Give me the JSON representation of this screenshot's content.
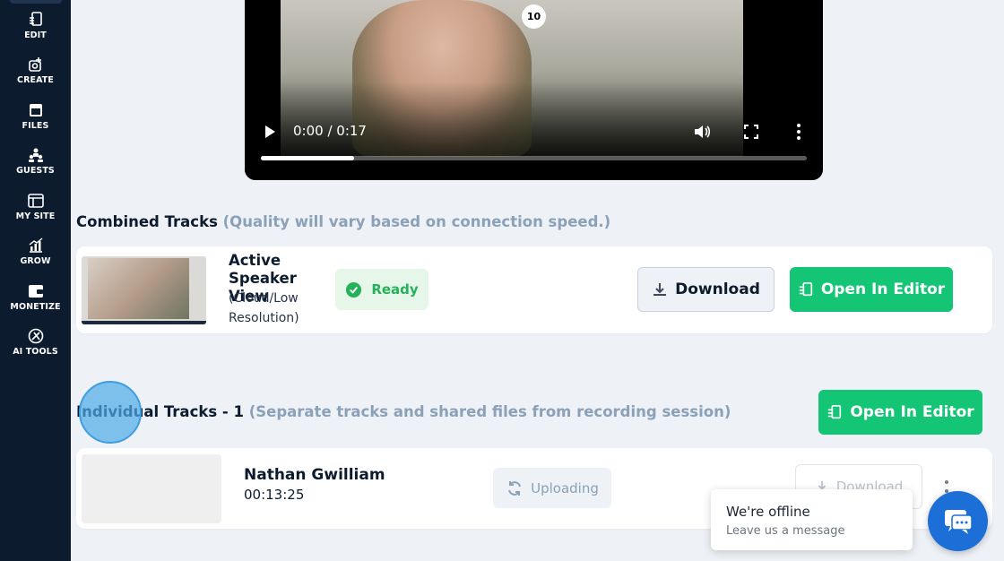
{
  "sidebar": {
    "items": [
      {
        "label": "EDIT",
        "icon": "edit-icon"
      },
      {
        "label": "CREATE",
        "icon": "create-icon"
      },
      {
        "label": "FILES",
        "icon": "files-icon"
      },
      {
        "label": "GUESTS",
        "icon": "guests-icon"
      },
      {
        "label": "MY SITE",
        "icon": "my-site-icon"
      },
      {
        "label": "GROW",
        "icon": "grow-icon"
      },
      {
        "label": "MONETIZE",
        "icon": "monetize-icon"
      },
      {
        "label": "AI TOOLS",
        "icon": "ai-tools-icon"
      }
    ]
  },
  "video": {
    "badge": "10",
    "time": "0:00 / 0:17",
    "progress": 0.17
  },
  "combined": {
    "title": "Combined Tracks",
    "note": "(Quality will vary based on connection speed.)",
    "track": {
      "title": "Active Speaker View",
      "subtitle": "(Cloud/Low Resolution)",
      "status": "Ready",
      "download_label": "Download",
      "editor_label": "Open In Editor"
    }
  },
  "individual": {
    "title": "Individual Tracks - 1",
    "note": "(Separate tracks and shared files from recording session)",
    "editor_label": "Open In Editor",
    "tracks": [
      {
        "name": "Nathan Gwilliam",
        "duration": "00:13:25",
        "status": "Uploading",
        "download_label": "Download"
      }
    ]
  },
  "chat": {
    "title": "We're offline",
    "subtitle": "Leave us a message"
  },
  "colors": {
    "sidebar_bg": "#0d1b2e",
    "accent_green": "#14c576",
    "ready_green": "#25b15a",
    "muted_text": "#8aa1b8",
    "chat_blue": "#1c6fd6"
  }
}
